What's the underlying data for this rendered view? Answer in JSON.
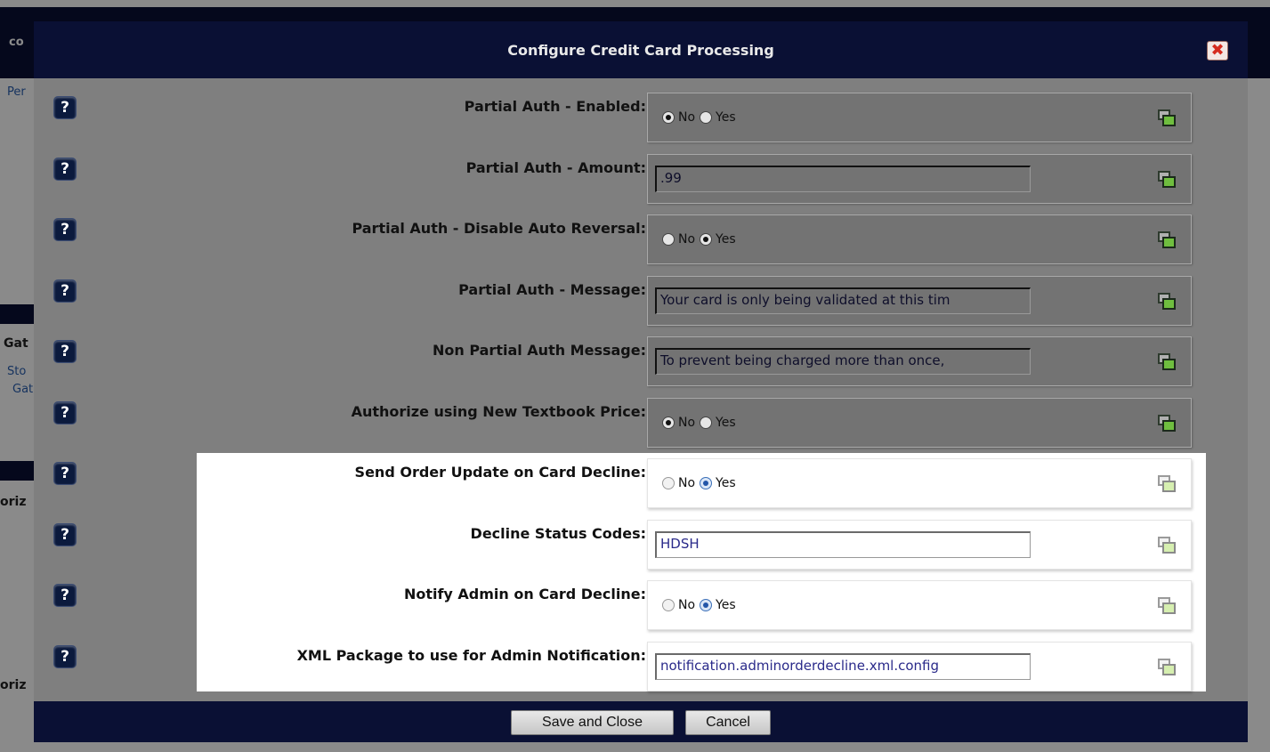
{
  "background": {
    "title_fragment": "co",
    "link_fragment_1": "Per",
    "heading_fragment": "Gat",
    "link_fragment_2": "Sto",
    "link_fragment_3": "Gat",
    "bold_fragment_1": "oriz",
    "bold_fragment_2": "oriz"
  },
  "modal": {
    "title": "Configure Credit Card Processing",
    "close_icon": "close-icon",
    "help_glyph": "?",
    "rows": [
      {
        "label": "Partial Auth - Enabled:",
        "type": "radio",
        "options": [
          "No",
          "Yes"
        ],
        "selected": "No",
        "highlighted": false
      },
      {
        "label": "Partial Auth - Amount:",
        "type": "text",
        "value": ".99",
        "highlighted": false
      },
      {
        "label": "Partial Auth - Disable Auto Reversal:",
        "type": "radio",
        "options": [
          "No",
          "Yes"
        ],
        "selected": "Yes",
        "highlighted": false
      },
      {
        "label": "Partial Auth - Message:",
        "type": "text",
        "value": "Your card is only being validated at this tim",
        "highlighted": false
      },
      {
        "label": "Non Partial Auth Message:",
        "type": "text",
        "value": "To prevent being charged more than once,",
        "highlighted": false
      },
      {
        "label": "Authorize using New Textbook Price:",
        "type": "radio",
        "options": [
          "No",
          "Yes"
        ],
        "selected": "No",
        "highlighted": false
      },
      {
        "label": "Send Order Update on Card Decline:",
        "type": "radio",
        "options": [
          "No",
          "Yes"
        ],
        "selected": "Yes",
        "highlighted": true
      },
      {
        "label": "Decline Status Codes:",
        "type": "text",
        "value": "HDSH",
        "highlighted": true
      },
      {
        "label": "Notify Admin on Card Decline:",
        "type": "radio",
        "options": [
          "No",
          "Yes"
        ],
        "selected": "Yes",
        "highlighted": true
      },
      {
        "label": "XML Package to use for Admin Notification:",
        "type": "text",
        "value": "notification.adminorderdecline.xml.config",
        "highlighted": true
      }
    ],
    "footer": {
      "save_label": "Save and Close",
      "cancel_label": "Cancel"
    }
  }
}
